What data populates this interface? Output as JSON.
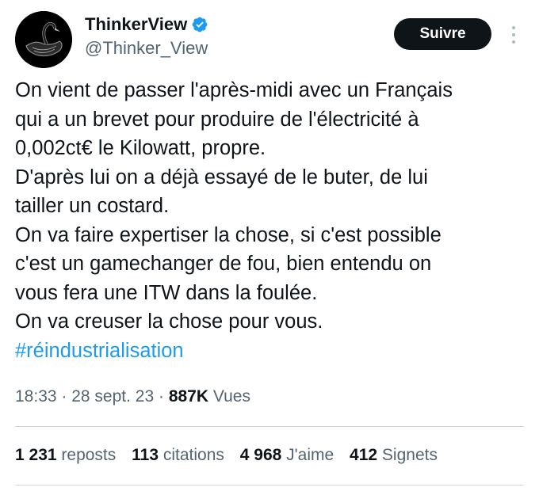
{
  "author": {
    "display_name": "ThinkerView",
    "handle": "@Thinker_View",
    "verified_color": "#1d9bf0",
    "avatar_icon": "black-swan-icon"
  },
  "follow_button": {
    "label": "Suivre"
  },
  "more_icon": "more-vertical-icon",
  "tweet": {
    "lines": [
      "On vient de passer l'après-midi avec un Français",
      "qui a un brevet pour produire de l'électricité à",
      "0,002ct€ le Kilowatt, propre.",
      "D'après lui on a déjà essayé de le buter, de lui",
      "tailler un costard.",
      "On va faire expertiser la chose, si c'est possible",
      "c'est un gamechanger de fou, bien entendu on",
      "vous fera une ITW dans la foulée.",
      "On va creuser la chose pour vous."
    ],
    "hashtag": "#réindustrialisation"
  },
  "meta": {
    "time": "18:33",
    "separator": " · ",
    "date": "28 sept. 23",
    "views_count": "887K",
    "views_label": "Vues"
  },
  "stats": {
    "reposts": {
      "count": "1 231",
      "label": "reposts"
    },
    "quotes": {
      "count": "113",
      "label": "citations"
    },
    "likes": {
      "count": "4 968",
      "label": "J'aime"
    },
    "bookmarks": {
      "count": "412",
      "label": "Signets"
    }
  },
  "colors": {
    "text": "#0f1419",
    "secondary": "#536471",
    "link": "#1d9bf0",
    "divider": "#cfd9de"
  }
}
